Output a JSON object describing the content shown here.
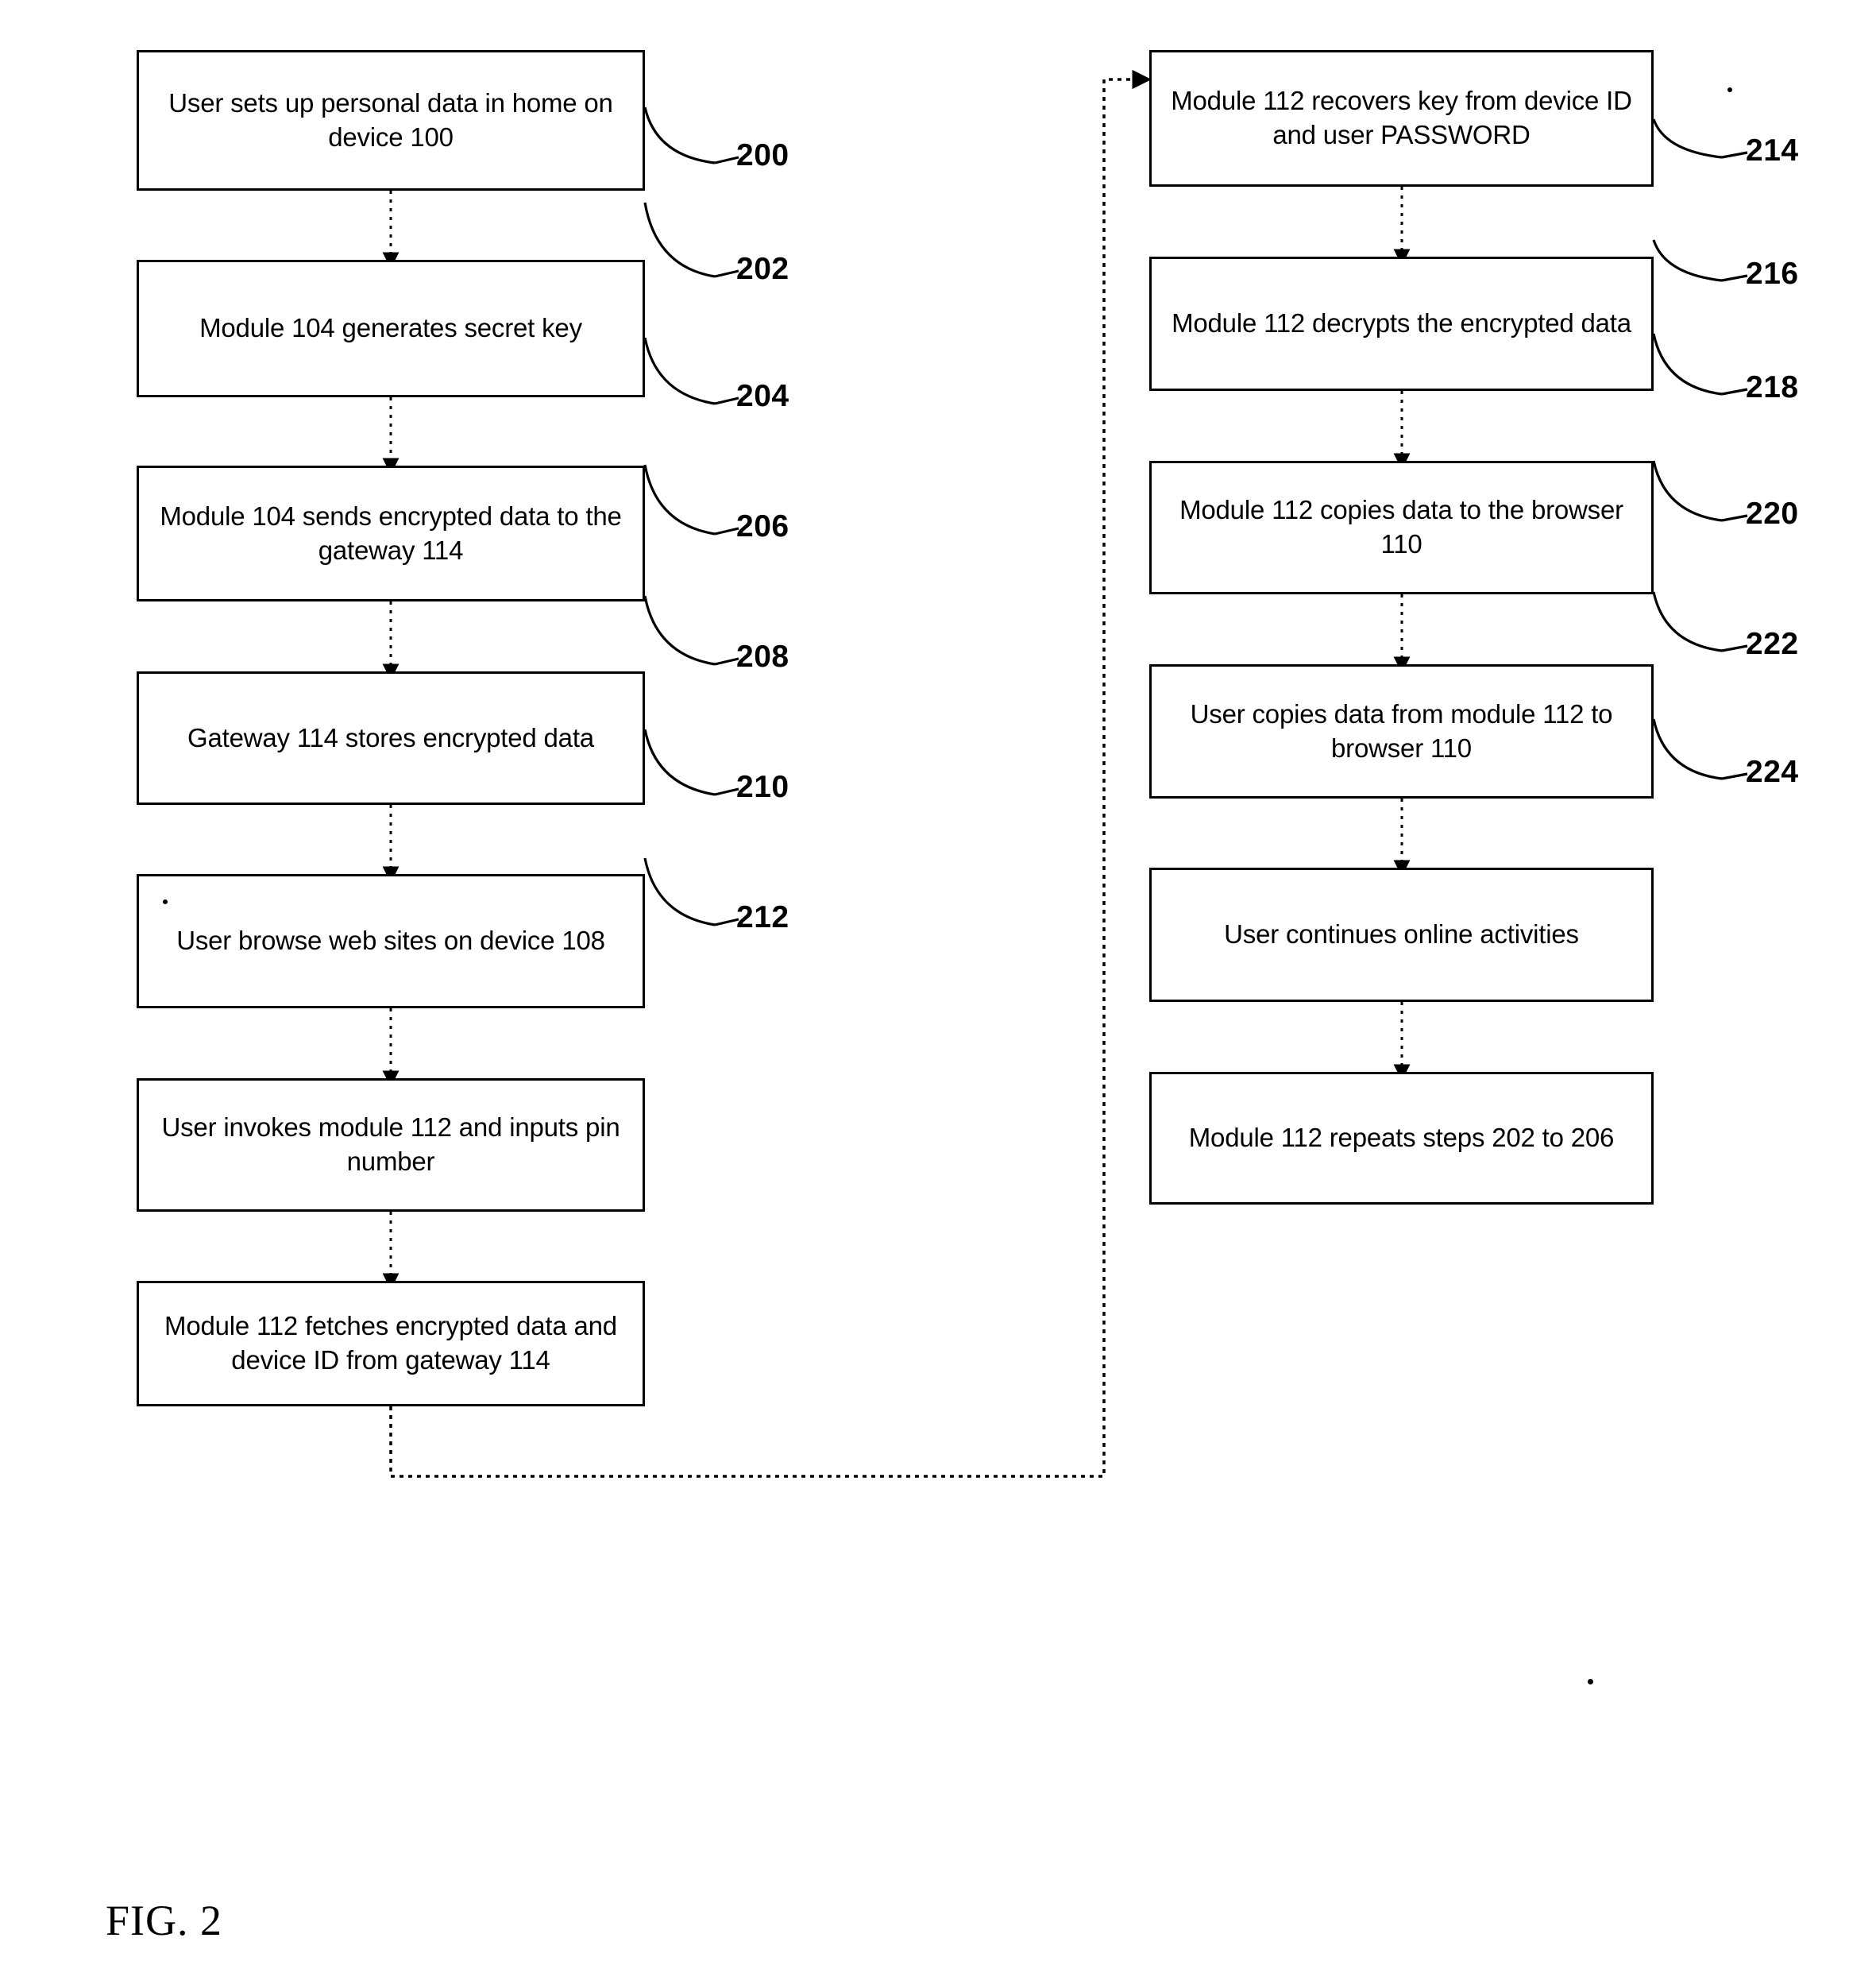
{
  "figure": {
    "caption": "FIG. 2",
    "title": "FIG. 2"
  },
  "columns": {
    "left": {
      "name": "left-flow-column",
      "steps": [
        {
          "ref": "200",
          "text": "User sets up personal data in home on device 100"
        },
        {
          "ref": "202",
          "text": "Module 104 generates secret key"
        },
        {
          "ref": "204",
          "text": "Module 104 sends encrypted data to the gateway 114"
        },
        {
          "ref": "206",
          "text": "Gateway 114 stores encrypted data"
        },
        {
          "ref": "208",
          "text": "User browse web sites on device 108"
        },
        {
          "ref": "210",
          "text": "User invokes module 112 and inputs pin number"
        },
        {
          "ref": "212",
          "text": "Module 112 fetches encrypted data and device ID from gateway 114"
        }
      ]
    },
    "right": {
      "name": "right-flow-column",
      "steps": [
        {
          "ref": "214",
          "text": "Module 112 recovers key from device ID and user PASSWORD"
        },
        {
          "ref": "216",
          "text": "Module 112 decrypts the encrypted data"
        },
        {
          "ref": "218",
          "text": "Module 112 copies data to the browser 110"
        },
        {
          "ref": "220",
          "text": "User copies data from module 112 to browser 110"
        },
        {
          "ref": "222",
          "text": "User continues online activities"
        },
        {
          "ref": "224",
          "text": "Module 112 repeats steps 202 to 206"
        }
      ]
    }
  },
  "colors": {
    "stroke": "#000000",
    "background": "#ffffff",
    "text": "#000000"
  }
}
